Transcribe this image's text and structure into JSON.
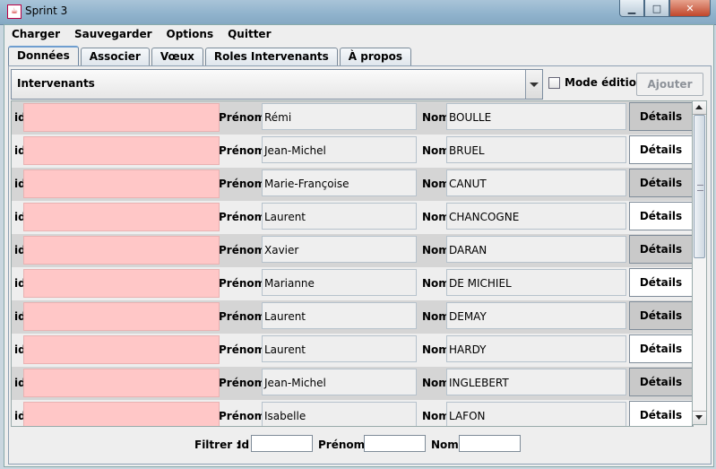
{
  "window": {
    "title": "Sprint 3"
  },
  "menu": [
    "Charger",
    "Sauvegarder",
    "Options",
    "Quitter"
  ],
  "tabs": [
    "Données",
    "Associer",
    "Vœux",
    "Roles Intervenants",
    "À propos"
  ],
  "active_tab": "Données",
  "controls": {
    "combo_value": "Intervenants",
    "mode_edition_label": "Mode édition",
    "mode_edition_checked": false,
    "add_label": "Ajouter"
  },
  "row_labels": {
    "id": "id",
    "prenom": "Prénom",
    "nom": "Nom",
    "details": "Détails"
  },
  "rows": [
    {
      "id": "",
      "prenom": "Rémi",
      "nom": "BOULLE"
    },
    {
      "id": "",
      "prenom": "Jean-Michel",
      "nom": "BRUEL"
    },
    {
      "id": "",
      "prenom": "Marie-Françoise",
      "nom": "CANUT"
    },
    {
      "id": "",
      "prenom": "Laurent",
      "nom": "CHANCOGNE"
    },
    {
      "id": "",
      "prenom": "Xavier",
      "nom": "DARAN"
    },
    {
      "id": "",
      "prenom": "Marianne",
      "nom": "DE MICHIEL"
    },
    {
      "id": "",
      "prenom": "Laurent",
      "nom": "DEMAY"
    },
    {
      "id": "",
      "prenom": "Laurent",
      "nom": "HARDY"
    },
    {
      "id": "",
      "prenom": "Jean-Michel",
      "nom": "INGLEBERT"
    },
    {
      "id": "",
      "prenom": "Isabelle",
      "nom": "LAFON"
    }
  ],
  "filter": {
    "label": "Filtrer :",
    "id_label": "Id",
    "prenom_label": "Prénom",
    "nom_label": "Nom",
    "id": "",
    "prenom": "",
    "nom": ""
  }
}
